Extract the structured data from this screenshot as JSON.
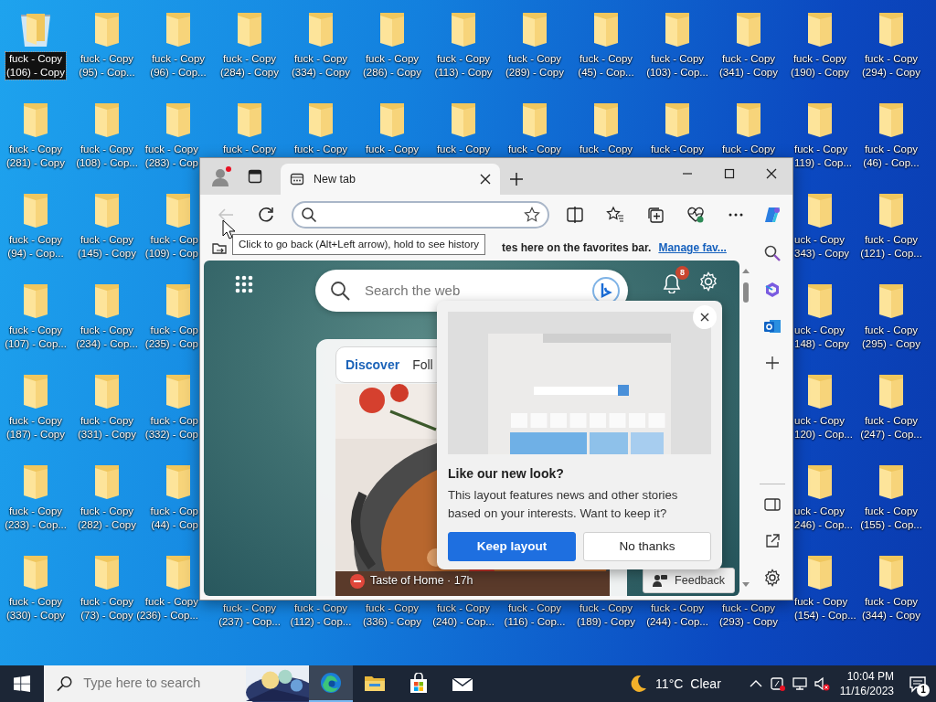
{
  "desktop": {
    "columns": [
      {
        "top": [
          {
            "kind": "recycle-bin",
            "selected": true,
            "lines": [
              "fuck - Copy",
              "(106) - Copy"
            ]
          },
          {
            "kind": "folder",
            "selected": false,
            "lines": [
              "fuck - Copy",
              "(281) - Copy"
            ]
          },
          {
            "kind": "folder",
            "selected": false,
            "lines": [
              "fuck - Copy",
              "(94) - Cop..."
            ]
          },
          {
            "kind": "folder",
            "selected": false,
            "lines": [
              "fuck - Copy",
              "(107) - Cop..."
            ]
          },
          {
            "kind": "folder",
            "selected": false,
            "lines": [
              "fuck - Copy",
              "(187) - Copy"
            ]
          },
          {
            "kind": "folder",
            "selected": false,
            "lines": [
              "fuck - Copy",
              "(233) - Cop..."
            ]
          },
          {
            "kind": "folder",
            "selected": false,
            "lines": [
              "fuck - Copy",
              "(330) - Copy"
            ]
          }
        ]
      },
      {
        "top": [
          {
            "kind": "folder",
            "selected": false,
            "lines": [
              "fuck - Copy",
              "(95) - Cop..."
            ]
          },
          {
            "kind": "folder",
            "selected": false,
            "lines": [
              "fuck - Copy",
              "(108) - Cop..."
            ]
          },
          {
            "kind": "folder",
            "selected": false,
            "lines": [
              "fuck - Copy",
              "(145) - Copy"
            ]
          },
          {
            "kind": "folder",
            "selected": false,
            "lines": [
              "fuck - Copy",
              "(234) - Cop..."
            ]
          },
          {
            "kind": "folder",
            "selected": false,
            "lines": [
              "fuck - Copy",
              "(331) - Copy"
            ]
          },
          {
            "kind": "folder",
            "selected": false,
            "lines": [
              "fuck - Copy",
              "(282) - Copy"
            ]
          },
          {
            "kind": "folder",
            "selected": false,
            "lines": [
              "fuck - Copy",
              "(73) - Copy"
            ]
          }
        ]
      },
      {
        "top": [
          {
            "kind": "folder",
            "selected": false,
            "lines": [
              "fuck - Copy",
              "(96) - Cop..."
            ]
          },
          {
            "kind": "folder",
            "selected": false,
            "lines": [
              "fuck - Copy",
              "(283) - Cop"
            ]
          },
          {
            "kind": "folder",
            "selected": false,
            "lines": [
              "fuck - Cop",
              "(109) - Cop"
            ]
          },
          {
            "kind": "folder",
            "selected": false,
            "lines": [
              "fuck - Cop",
              "(235) - Cop"
            ]
          },
          {
            "kind": "folder",
            "selected": false,
            "lines": [
              "fuck - Cop",
              "(332) - Cop"
            ]
          },
          {
            "kind": "folder",
            "selected": false,
            "lines": [
              "fuck - Cop",
              "(44) - Cop"
            ]
          },
          {
            "kind": "folder",
            "selected": false,
            "lines": [
              "fuck - Copy",
              "(236) - Cop..."
            ]
          }
        ]
      },
      {
        "top": [
          {
            "kind": "folder",
            "selected": false,
            "lines": [
              "fuck - Copy",
              "(284) - Copy"
            ]
          },
          {
            "kind": "folder",
            "selected": false,
            "lines": [
              "fuck - Copy"
            ]
          }
        ],
        "bottom": [
          {
            "kind": "folder",
            "selected": false,
            "lines": [
              "fuck - Copy",
              "(237) - Cop..."
            ]
          }
        ]
      },
      {
        "top": [
          {
            "kind": "folder",
            "selected": false,
            "lines": [
              "fuck - Copy",
              "(334) - Copy"
            ]
          },
          {
            "kind": "folder",
            "selected": false,
            "lines": [
              "fuck - Copy"
            ]
          }
        ],
        "bottom": [
          {
            "kind": "folder",
            "selected": false,
            "lines": [
              "fuck - Copy",
              "(112) - Cop..."
            ]
          }
        ]
      },
      {
        "top": [
          {
            "kind": "folder",
            "selected": false,
            "lines": [
              "fuck - Copy",
              "(286) - Copy"
            ]
          },
          {
            "kind": "folder",
            "selected": false,
            "lines": [
              "fuck - Copy"
            ]
          }
        ],
        "bottom": [
          {
            "kind": "folder",
            "selected": false,
            "lines": [
              "fuck - Copy",
              "(336) - Copy"
            ]
          }
        ]
      },
      {
        "top": [
          {
            "kind": "folder",
            "selected": false,
            "lines": [
              "fuck - Copy",
              "(113) - Copy"
            ]
          },
          {
            "kind": "folder",
            "selected": false,
            "lines": [
              "fuck - Copy"
            ]
          }
        ],
        "bottom": [
          {
            "kind": "folder",
            "selected": false,
            "lines": [
              "fuck - Copy",
              "(240) - Cop..."
            ]
          }
        ]
      },
      {
        "top": [
          {
            "kind": "folder",
            "selected": false,
            "lines": [
              "fuck - Copy",
              "(289) - Copy"
            ]
          },
          {
            "kind": "folder",
            "selected": false,
            "lines": [
              "fuck - Copy"
            ]
          }
        ],
        "bottom": [
          {
            "kind": "folder",
            "selected": false,
            "lines": [
              "fuck - Copy",
              "(116) - Cop..."
            ]
          }
        ]
      },
      {
        "top": [
          {
            "kind": "folder",
            "selected": false,
            "lines": [
              "fuck - Copy",
              "(45) - Cop..."
            ]
          },
          {
            "kind": "folder",
            "selected": false,
            "lines": [
              "fuck - Copy"
            ]
          }
        ],
        "bottom": [
          {
            "kind": "folder",
            "selected": false,
            "lines": [
              "fuck - Copy",
              "(189) - Copy"
            ]
          }
        ]
      },
      {
        "top": [
          {
            "kind": "folder",
            "selected": false,
            "lines": [
              "fuck - Copy",
              "(103) - Cop..."
            ]
          },
          {
            "kind": "folder",
            "selected": false,
            "lines": [
              "fuck - Copy"
            ]
          }
        ],
        "bottom": [
          {
            "kind": "folder",
            "selected": false,
            "lines": [
              "fuck - Copy",
              "(244) - Cop..."
            ]
          }
        ]
      },
      {
        "top": [
          {
            "kind": "folder",
            "selected": false,
            "lines": [
              "fuck - Copy",
              "(341) - Copy"
            ]
          },
          {
            "kind": "folder",
            "selected": false,
            "lines": [
              "fuck - Copy"
            ]
          }
        ],
        "bottom": [
          {
            "kind": "folder",
            "selected": false,
            "lines": [
              "fuck - Copy",
              "(293) - Copy"
            ]
          }
        ]
      },
      {
        "top": [
          {
            "kind": "folder",
            "selected": false,
            "lines": [
              "fuck - Copy",
              "(190) - Copy"
            ]
          },
          {
            "kind": "folder",
            "selected": false,
            "lines": [
              "fuck - Copy",
              "119) - Cop..."
            ]
          },
          {
            "kind": "folder",
            "selected": false,
            "lines": [
              "uck - Copy",
              "343) - Copy"
            ]
          },
          {
            "kind": "folder",
            "selected": false,
            "lines": [
              "uck - Copy",
              "148) - Copy"
            ]
          },
          {
            "kind": "folder",
            "selected": false,
            "lines": [
              "uck - Copy",
              "120) - Cop..."
            ]
          },
          {
            "kind": "folder",
            "selected": false,
            "lines": [
              "uck - Copy",
              "246) - Cop..."
            ]
          },
          {
            "kind": "folder",
            "selected": false,
            "lines": [
              "fuck - Copy",
              "(154) - Cop..."
            ]
          }
        ]
      },
      {
        "top": [
          {
            "kind": "folder",
            "selected": false,
            "lines": [
              "fuck - Copy",
              "(294) - Copy"
            ]
          },
          {
            "kind": "folder",
            "selected": false,
            "lines": [
              "fuck - Copy",
              "(46) - Cop..."
            ]
          },
          {
            "kind": "folder",
            "selected": false,
            "lines": [
              "fuck - Copy",
              "(121) - Cop..."
            ]
          },
          {
            "kind": "folder",
            "selected": false,
            "lines": [
              "fuck - Copy",
              "(295) - Copy"
            ]
          },
          {
            "kind": "folder",
            "selected": false,
            "lines": [
              "fuck - Copy",
              "(247) - Cop..."
            ]
          },
          {
            "kind": "folder",
            "selected": false,
            "lines": [
              "fuck - Copy",
              "(155) - Cop..."
            ]
          },
          {
            "kind": "folder",
            "selected": false,
            "lines": [
              "fuck - Copy",
              "(344) - Copy"
            ]
          }
        ]
      }
    ]
  },
  "browser": {
    "tabs": [
      {
        "label": "New tab",
        "selected": true
      }
    ],
    "back_button": {
      "disabled": true
    },
    "tooltip": "Click to go back (Alt+Left arrow), hold to see history",
    "favorites_bar": {
      "text": "tes here on the favorites bar.",
      "link": "Manage fav..."
    },
    "new_tab_page": {
      "search": {
        "placeholder": "Search the web"
      },
      "notification_count": "8",
      "feed_tabs": [
        {
          "label": "Discover",
          "selected": true
        },
        {
          "label": "Foll",
          "selected": false
        }
      ],
      "card": {
        "source": "Taste of Home · 17h"
      },
      "popup": {
        "title": "Like our new look?",
        "body": "This layout features news and other stories based on your interests. Want to keep it?",
        "buttons": [
          {
            "label": "Keep layout",
            "kind": "primary"
          },
          {
            "label": "No thanks",
            "kind": "secondary"
          }
        ]
      },
      "feedback": "Feedback"
    }
  },
  "taskbar": {
    "search": {
      "placeholder": "Type here to search"
    },
    "apps": [
      {
        "kind": "edge",
        "active": true
      },
      {
        "kind": "explorer",
        "active": false
      },
      {
        "kind": "store",
        "active": false
      },
      {
        "kind": "mail",
        "active": false
      }
    ],
    "weather": {
      "temperature": "11°C",
      "condition": "Clear"
    },
    "clock": {
      "time": "10:04 PM",
      "date": "11/16/2023"
    },
    "notification_count": "1"
  }
}
